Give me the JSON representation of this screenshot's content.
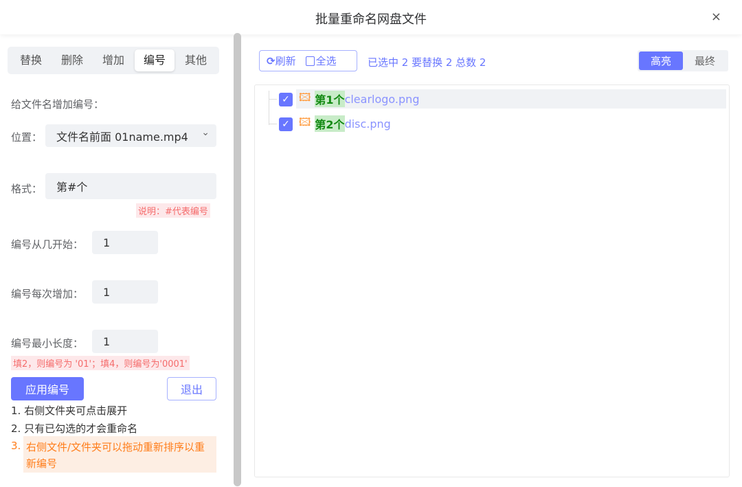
{
  "title": "批量重命名网盘文件",
  "close": "×",
  "tabs": [
    "替换",
    "删除",
    "增加",
    "编号",
    "其他"
  ],
  "heading": "给文件名增加编号：",
  "position": {
    "label": "位置：",
    "value": "文件名前面 01name.mp4",
    "chevron": "⌄"
  },
  "format": {
    "label": "格式：",
    "value": "第#个",
    "note": "说明：#代表编号"
  },
  "start": {
    "label": "编号从几开始：",
    "value": "1"
  },
  "step": {
    "label": "编号每次增加：",
    "value": "1"
  },
  "minlen": {
    "label": "编号最小长度：",
    "value": "1",
    "note": "填2，则编号为 '01'；填4，则编号为'0001'"
  },
  "apply": "应用编号",
  "exit": "退出",
  "tips": [
    "1. 右侧文件夹可点击展开",
    "2. 只有已勾选的才会重命名",
    "3.",
    "右侧文件/文件夹可以拖动重新排序以重新编号"
  ],
  "toolbar": {
    "refresh": "刷新",
    "select_all": "全选",
    "status": "已选中 2 要替换 2 总数 2",
    "highlight": "高亮",
    "final": "最终"
  },
  "files": [
    {
      "prefix": "第1个",
      "name": "clearlogo.png",
      "checked": true
    },
    {
      "prefix": "第2个",
      "name": "disc.png",
      "checked": true
    }
  ]
}
